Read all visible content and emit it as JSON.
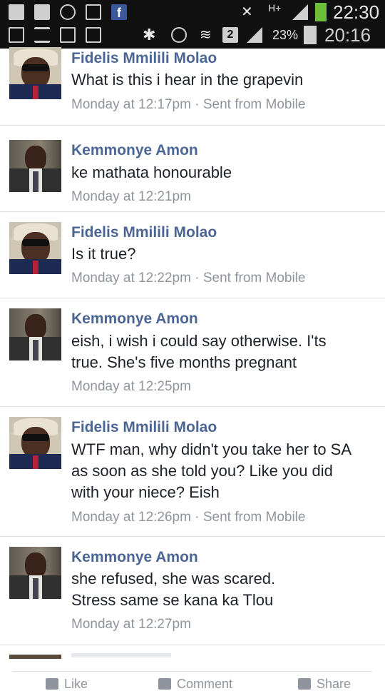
{
  "status_bar": {
    "time_outer": "22:30",
    "time_inner": "20:16",
    "network": "H+",
    "battery_inner": "23%",
    "notification_badge": "2",
    "icons_row1": [
      "facebook-icon",
      "facebook-icon",
      "whatsapp-icon",
      "gallery-icon",
      "facebook-icon"
    ],
    "icons_row2": [
      "chart-icon",
      "text-icon",
      "camera-icon",
      "camera-icon",
      "bluetooth-icon",
      "alarm-icon",
      "wifi-icon"
    ]
  },
  "messages": [
    {
      "author": "Fidelis Mmilili Molao",
      "lines": [
        "What is this i hear in the grapevin"
      ],
      "time": "Monday at 12:17pm",
      "source": "Sent from Mobile"
    },
    {
      "author": "Kemmonye Amon",
      "lines": [
        "ke mathata honourable"
      ],
      "time": "Monday at 12:21pm",
      "source": ""
    },
    {
      "author": "Fidelis Mmilili Molao",
      "lines": [
        "Is it true?"
      ],
      "time": "Monday at 12:22pm",
      "source": "Sent from Mobile"
    },
    {
      "author": "Kemmonye Amon",
      "lines": [
        "eish, i wish i could say otherwise. I'ts",
        "true. She's five months pregnant"
      ],
      "time": "Monday at 12:25pm",
      "source": ""
    },
    {
      "author": "Fidelis Mmilili Molao",
      "lines": [
        "WTF man, why didn't you take her to SA",
        "as soon as she told you? Like you did",
        "with your niece? Eish"
      ],
      "time": "Monday at 12:26pm",
      "source": "Sent from Mobile"
    },
    {
      "author": "Kemmonye Amon",
      "lines": [
        "she refused, she was scared.",
        "Stress same se kana ka Tlou"
      ],
      "time": "Monday at 12:27pm",
      "source": ""
    }
  ],
  "meta_separator": " · ",
  "actions": {
    "like": "Like",
    "comment": "Comment",
    "share": "Share"
  }
}
